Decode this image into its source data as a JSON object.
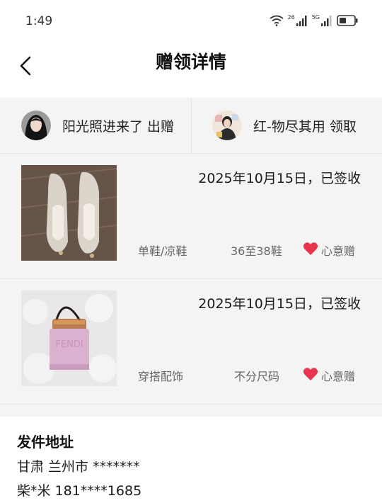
{
  "status_bar": {
    "time": "1:49",
    "net_a": "26",
    "net_b": "5G",
    "icons": [
      "wifi-icon",
      "signal-icon",
      "signal-icon",
      "battery-icon"
    ]
  },
  "header": {
    "title": "赠领详情",
    "back_icon": "chevron-left-icon"
  },
  "parties": {
    "giver": {
      "name": "阳光照进来了",
      "role": "出赠"
    },
    "receiver": {
      "name": "红-物尽其用",
      "role": "领取"
    }
  },
  "items": [
    {
      "date": "2025年10月15日，已签收",
      "category": "单鞋/凉鞋",
      "size": "36至38鞋",
      "gift_type": "心意赠"
    },
    {
      "date": "2025年10月15日，已签收",
      "category": "穿搭配饰",
      "size": "不分尺码",
      "gift_type": "心意赠"
    }
  ],
  "address": {
    "title": "发件地址",
    "region": "甘肃 兰州市 *******",
    "contact": "柴*米 181****1685"
  },
  "colors": {
    "heart": "#e8344e",
    "background": "#f4f4f4",
    "text": "#1a1a1a",
    "muted": "#666666"
  }
}
